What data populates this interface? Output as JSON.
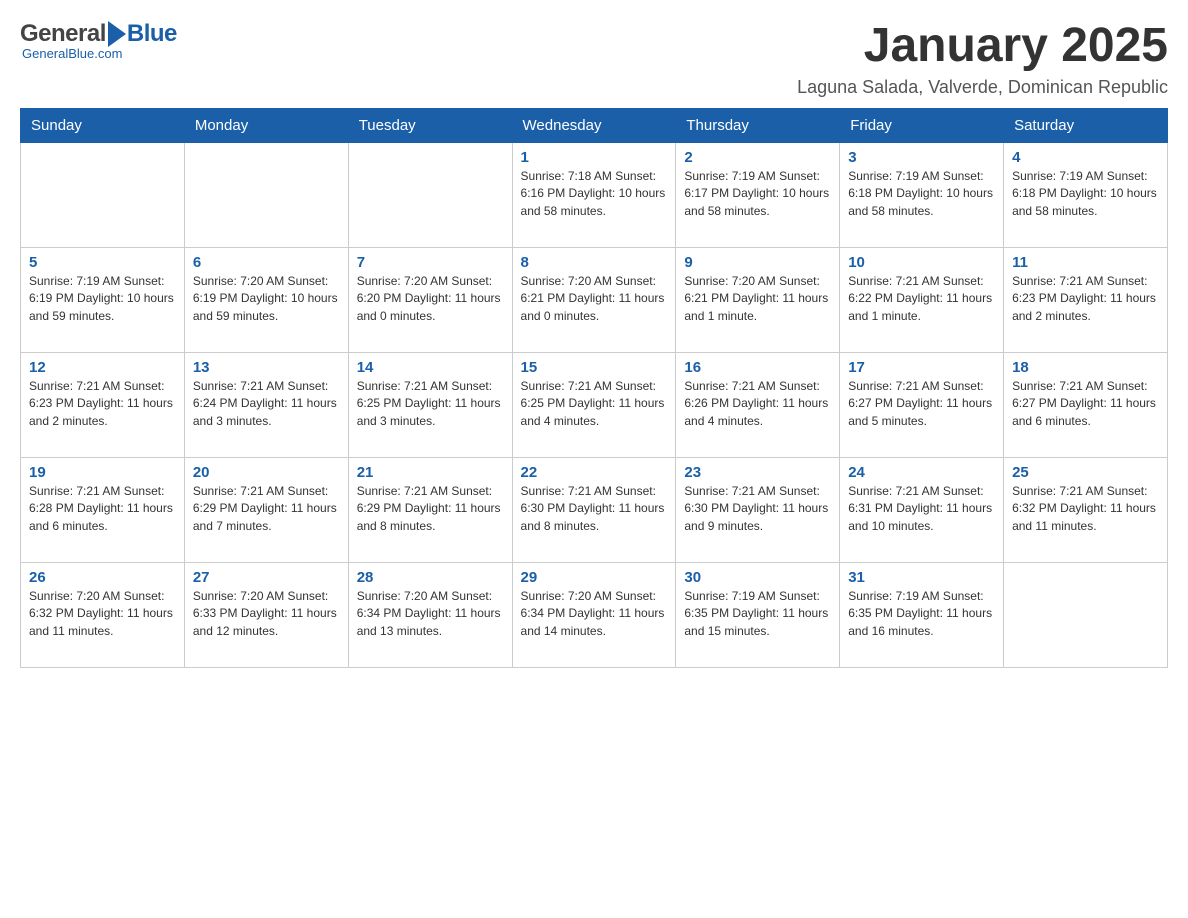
{
  "logo": {
    "general": "General",
    "blue": "Blue",
    "tagline": "GeneralBlue.com"
  },
  "header": {
    "title": "January 2025",
    "subtitle": "Laguna Salada, Valverde, Dominican Republic"
  },
  "weekdays": [
    "Sunday",
    "Monday",
    "Tuesday",
    "Wednesday",
    "Thursday",
    "Friday",
    "Saturday"
  ],
  "weeks": [
    [
      {
        "day": "",
        "info": ""
      },
      {
        "day": "",
        "info": ""
      },
      {
        "day": "",
        "info": ""
      },
      {
        "day": "1",
        "info": "Sunrise: 7:18 AM\nSunset: 6:16 PM\nDaylight: 10 hours\nand 58 minutes."
      },
      {
        "day": "2",
        "info": "Sunrise: 7:19 AM\nSunset: 6:17 PM\nDaylight: 10 hours\nand 58 minutes."
      },
      {
        "day": "3",
        "info": "Sunrise: 7:19 AM\nSunset: 6:18 PM\nDaylight: 10 hours\nand 58 minutes."
      },
      {
        "day": "4",
        "info": "Sunrise: 7:19 AM\nSunset: 6:18 PM\nDaylight: 10 hours\nand 58 minutes."
      }
    ],
    [
      {
        "day": "5",
        "info": "Sunrise: 7:19 AM\nSunset: 6:19 PM\nDaylight: 10 hours\nand 59 minutes."
      },
      {
        "day": "6",
        "info": "Sunrise: 7:20 AM\nSunset: 6:19 PM\nDaylight: 10 hours\nand 59 minutes."
      },
      {
        "day": "7",
        "info": "Sunrise: 7:20 AM\nSunset: 6:20 PM\nDaylight: 11 hours\nand 0 minutes."
      },
      {
        "day": "8",
        "info": "Sunrise: 7:20 AM\nSunset: 6:21 PM\nDaylight: 11 hours\nand 0 minutes."
      },
      {
        "day": "9",
        "info": "Sunrise: 7:20 AM\nSunset: 6:21 PM\nDaylight: 11 hours\nand 1 minute."
      },
      {
        "day": "10",
        "info": "Sunrise: 7:21 AM\nSunset: 6:22 PM\nDaylight: 11 hours\nand 1 minute."
      },
      {
        "day": "11",
        "info": "Sunrise: 7:21 AM\nSunset: 6:23 PM\nDaylight: 11 hours\nand 2 minutes."
      }
    ],
    [
      {
        "day": "12",
        "info": "Sunrise: 7:21 AM\nSunset: 6:23 PM\nDaylight: 11 hours\nand 2 minutes."
      },
      {
        "day": "13",
        "info": "Sunrise: 7:21 AM\nSunset: 6:24 PM\nDaylight: 11 hours\nand 3 minutes."
      },
      {
        "day": "14",
        "info": "Sunrise: 7:21 AM\nSunset: 6:25 PM\nDaylight: 11 hours\nand 3 minutes."
      },
      {
        "day": "15",
        "info": "Sunrise: 7:21 AM\nSunset: 6:25 PM\nDaylight: 11 hours\nand 4 minutes."
      },
      {
        "day": "16",
        "info": "Sunrise: 7:21 AM\nSunset: 6:26 PM\nDaylight: 11 hours\nand 4 minutes."
      },
      {
        "day": "17",
        "info": "Sunrise: 7:21 AM\nSunset: 6:27 PM\nDaylight: 11 hours\nand 5 minutes."
      },
      {
        "day": "18",
        "info": "Sunrise: 7:21 AM\nSunset: 6:27 PM\nDaylight: 11 hours\nand 6 minutes."
      }
    ],
    [
      {
        "day": "19",
        "info": "Sunrise: 7:21 AM\nSunset: 6:28 PM\nDaylight: 11 hours\nand 6 minutes."
      },
      {
        "day": "20",
        "info": "Sunrise: 7:21 AM\nSunset: 6:29 PM\nDaylight: 11 hours\nand 7 minutes."
      },
      {
        "day": "21",
        "info": "Sunrise: 7:21 AM\nSunset: 6:29 PM\nDaylight: 11 hours\nand 8 minutes."
      },
      {
        "day": "22",
        "info": "Sunrise: 7:21 AM\nSunset: 6:30 PM\nDaylight: 11 hours\nand 8 minutes."
      },
      {
        "day": "23",
        "info": "Sunrise: 7:21 AM\nSunset: 6:30 PM\nDaylight: 11 hours\nand 9 minutes."
      },
      {
        "day": "24",
        "info": "Sunrise: 7:21 AM\nSunset: 6:31 PM\nDaylight: 11 hours\nand 10 minutes."
      },
      {
        "day": "25",
        "info": "Sunrise: 7:21 AM\nSunset: 6:32 PM\nDaylight: 11 hours\nand 11 minutes."
      }
    ],
    [
      {
        "day": "26",
        "info": "Sunrise: 7:20 AM\nSunset: 6:32 PM\nDaylight: 11 hours\nand 11 minutes."
      },
      {
        "day": "27",
        "info": "Sunrise: 7:20 AM\nSunset: 6:33 PM\nDaylight: 11 hours\nand 12 minutes."
      },
      {
        "day": "28",
        "info": "Sunrise: 7:20 AM\nSunset: 6:34 PM\nDaylight: 11 hours\nand 13 minutes."
      },
      {
        "day": "29",
        "info": "Sunrise: 7:20 AM\nSunset: 6:34 PM\nDaylight: 11 hours\nand 14 minutes."
      },
      {
        "day": "30",
        "info": "Sunrise: 7:19 AM\nSunset: 6:35 PM\nDaylight: 11 hours\nand 15 minutes."
      },
      {
        "day": "31",
        "info": "Sunrise: 7:19 AM\nSunset: 6:35 PM\nDaylight: 11 hours\nand 16 minutes."
      },
      {
        "day": "",
        "info": ""
      }
    ]
  ]
}
